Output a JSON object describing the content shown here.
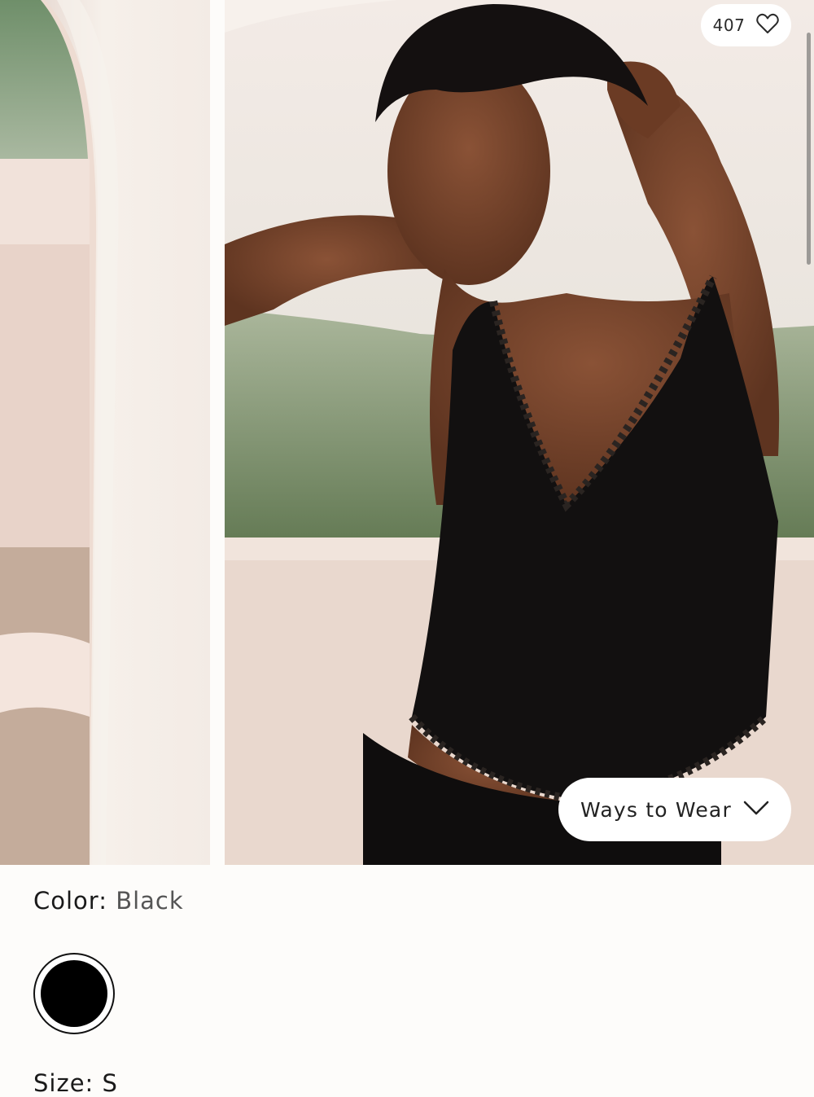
{
  "gallery": {
    "likes": {
      "count": "407",
      "icon": "heart-outline-icon"
    },
    "ways_to_wear": {
      "label": "Ways to Wear",
      "icon": "chevron-down-icon"
    }
  },
  "product": {
    "color": {
      "label": "Color:",
      "value": "Black",
      "swatch_color": "#000000"
    },
    "size": {
      "label": "Size:",
      "value": "S"
    }
  }
}
